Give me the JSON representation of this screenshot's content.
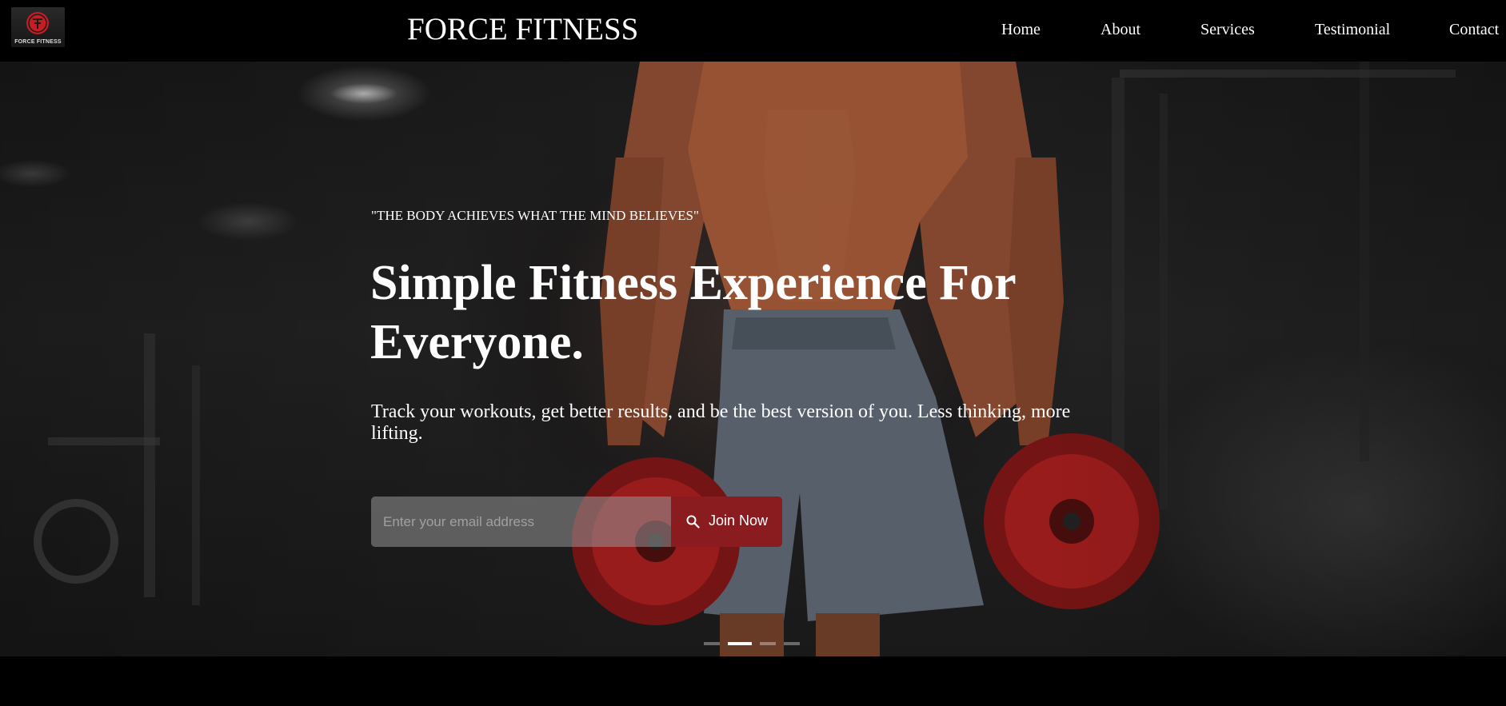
{
  "header": {
    "logo_text": "FORCE FITNESS",
    "brand_title": "FORCE FITNESS",
    "nav": [
      {
        "label": "Home"
      },
      {
        "label": "About"
      },
      {
        "label": "Services"
      },
      {
        "label": "Testimonial"
      },
      {
        "label": "Contact"
      }
    ]
  },
  "hero": {
    "quote": "\"THE BODY ACHIEVES WHAT THE MIND BELIEVES\"",
    "headline": "Simple Fitness Experience For Everyone.",
    "subtext": "Track your workouts, get better results, and be the best version of you. Less thinking, more lifting.",
    "email_placeholder": "Enter your email address",
    "email_value": "",
    "join_label": "Join Now",
    "join_icon": "search-icon",
    "slides_total": 4,
    "active_slide": 2
  },
  "colors": {
    "background": "#000000",
    "accent": "#8a1c1f",
    "logo_red": "#c41e24",
    "text": "#ffffff"
  }
}
